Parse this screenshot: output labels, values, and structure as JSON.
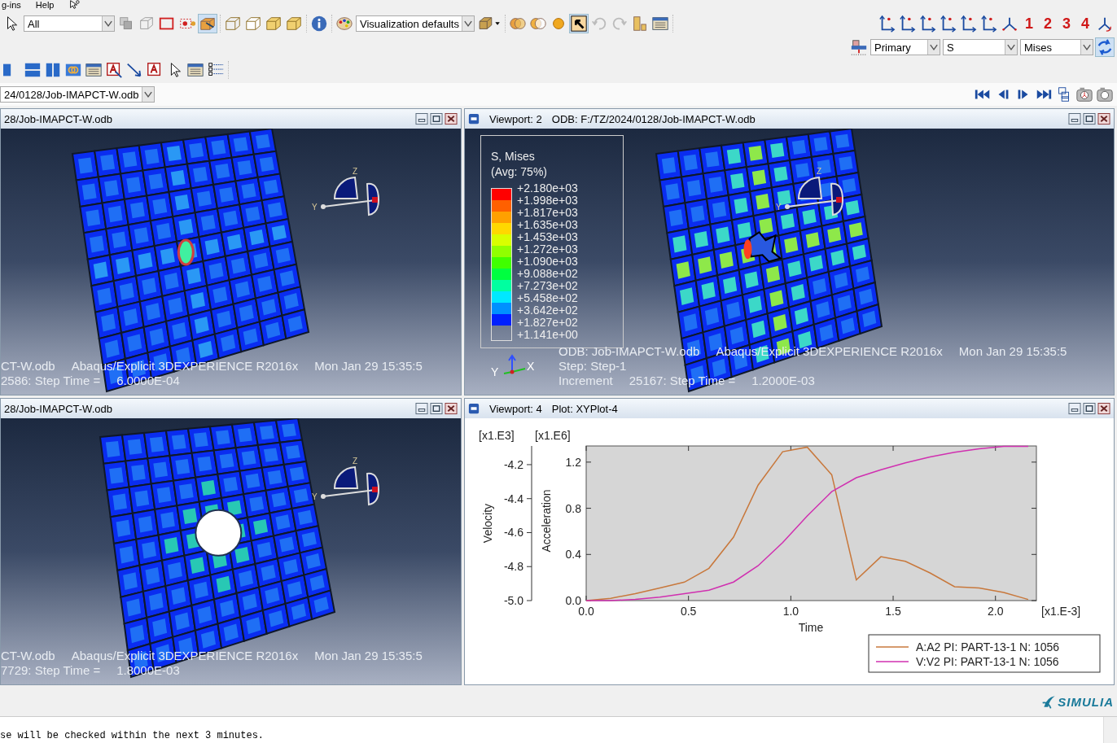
{
  "menu": [
    "g-ins",
    "Help"
  ],
  "toolbar": {
    "selection_filter": "All",
    "visualization": "Visualization defaults",
    "view_buttons": [
      "1",
      "2",
      "3",
      "4"
    ]
  },
  "field_output": {
    "position": "Primary",
    "variable": "S",
    "invariant": "Mises"
  },
  "odb_selector": "24/0128/Job-IMAPCT-W.odb",
  "viewports": [
    {
      "kind": "contour_spot",
      "title": [
        "28/Job-IMAPCT-W.odb"
      ],
      "orientation_labels": [
        "Z",
        "Y"
      ],
      "info_lines": [
        [
          "CT-W.odb",
          "Abaqus/Explicit 3DEXPERIENCE R2016x",
          "Mon Jan 29 15:35:5"
        ],
        [
          "2586: Step Time =",
          "6.0000E-04"
        ]
      ]
    },
    {
      "kind": "contour_band",
      "title": [
        "Viewport: 2",
        "ODB: F:/TZ/2024/0128/Job-IMAPCT-W.odb"
      ],
      "orientation_labels": [
        "Z",
        "Y"
      ],
      "legend": {
        "title": "S, Mises",
        "subtitle": "(Avg: 75%)",
        "values": [
          "+2.180e+03",
          "+1.998e+03",
          "+1.817e+03",
          "+1.635e+03",
          "+1.453e+03",
          "+1.272e+03",
          "+1.090e+03",
          "+9.088e+02",
          "+7.273e+02",
          "+5.458e+02",
          "+3.642e+02",
          "+1.827e+02",
          "+1.141e+00"
        ],
        "bands": [
          {
            "color": "#ff0000"
          },
          {
            "color": "#ff6000"
          },
          {
            "color": "#ffa000"
          },
          {
            "color": "#ffd800"
          },
          {
            "color": "#d8ff00"
          },
          {
            "color": "#90ff00"
          },
          {
            "color": "#40ff00"
          },
          {
            "color": "#00ff40"
          },
          {
            "color": "#00ffa0"
          },
          {
            "color": "#00e8ff"
          },
          {
            "color": "#0090ff"
          },
          {
            "color": "#0020ff"
          }
        ]
      },
      "triad_labels": [
        "Y",
        "X"
      ],
      "info_lines": [
        [
          "ODB: Job-IMAPCT-W.odb",
          "Abaqus/Explicit 3DEXPERIENCE R2016x",
          "Mon Jan 29 15:35:5"
        ],
        [
          "Step: Step-1"
        ],
        [
          "Increment",
          "25167: Step Time =",
          "1.2000E-03"
        ]
      ]
    },
    {
      "kind": "contour_hole",
      "title": [
        "28/Job-IMAPCT-W.odb"
      ],
      "orientation_labels": [
        "Z",
        "Y"
      ],
      "info_lines": [
        [
          "CT-W.odb",
          "Abaqus/Explicit 3DEXPERIENCE R2016x",
          "Mon Jan 29 15:35:5"
        ],
        [
          "7729: Step Time =",
          "1.8000E-03"
        ]
      ]
    },
    {
      "kind": "xyplot",
      "title": [
        "Viewport: 4",
        "Plot: XYPlot-4"
      ],
      "axis_multipliers": [
        "[x1.E3]",
        "[x1.E6]",
        "[x1.E-3]"
      ],
      "chart_data": {
        "type": "line",
        "xlabel": "Time",
        "ylabel": "Acceleration",
        "y2label": "Velocity",
        "legend": "lower right",
        "x": [
          0,
          0.12,
          0.24,
          0.36,
          0.48,
          0.6,
          0.72,
          0.84,
          0.96,
          1.08,
          1.2,
          1.32,
          1.44,
          1.56,
          1.68,
          1.8,
          1.92,
          2.04,
          2.16
        ],
        "xlim": [
          0,
          2.2
        ],
        "ylim": [
          0,
          1.34
        ],
        "y2lim": [
          -5.0,
          -4.09
        ],
        "xticks": [
          {
            "value": 0,
            "label": "0.0"
          },
          {
            "value": 0.5,
            "label": "0.5"
          },
          {
            "value": 1,
            "label": "1.0"
          },
          {
            "value": 1.5,
            "label": "1.5"
          },
          {
            "value": 2,
            "label": "2.0"
          }
        ],
        "yticks": [
          {
            "value": 0,
            "label": "0.0"
          },
          {
            "value": 0.4,
            "label": "0.4"
          },
          {
            "value": 0.8,
            "label": "0.8"
          },
          {
            "value": 1.2,
            "label": "1.2"
          }
        ],
        "y2ticks": [
          {
            "value": -5.0,
            "label": "-5.0"
          },
          {
            "value": -4.8,
            "label": "-4.8"
          },
          {
            "value": -4.6,
            "label": "-4.6"
          },
          {
            "value": -4.4,
            "label": "-4.4"
          },
          {
            "value": -4.2,
            "label": "-4.2"
          }
        ],
        "series": [
          {
            "name": "A:A2 PI: PART-13-1 N: 1056",
            "color": "#c8783c",
            "axis": "y",
            "values": [
              0,
              0.02,
              0.06,
              0.11,
              0.16,
              0.28,
              0.55,
              1.0,
              1.29,
              1.33,
              1.09,
              0.18,
              0.38,
              0.34,
              0.24,
              0.12,
              0.11,
              0.07,
              0.01
            ]
          },
          {
            "name": "V:V2 PI: PART-13-1 N: 1056",
            "color": "#d030b0",
            "axis": "y2",
            "values": [
              -5.0,
              -5.0,
              -4.993,
              -4.98,
              -4.959,
              -4.939,
              -4.891,
              -4.795,
              -4.659,
              -4.502,
              -4.359,
              -4.277,
              -4.23,
              -4.189,
              -4.155,
              -4.127,
              -4.107,
              -4.093,
              -4.093
            ]
          }
        ]
      }
    }
  ],
  "brand": "SIMULIA",
  "messages": [
    "se will be checked within the next 3 minutes."
  ]
}
